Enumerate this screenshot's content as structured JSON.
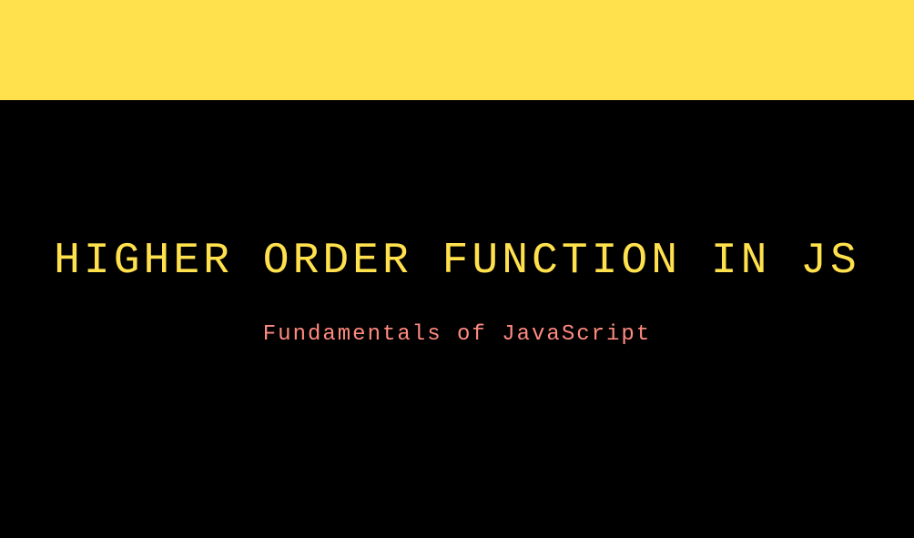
{
  "slide": {
    "title": "HIGHER ORDER FUNCTION IN JS",
    "subtitle": "Fundamentals of JavaScript"
  },
  "colors": {
    "accent": "#ffe04d",
    "subtitle": "#ff8a80",
    "background": "#000000"
  }
}
